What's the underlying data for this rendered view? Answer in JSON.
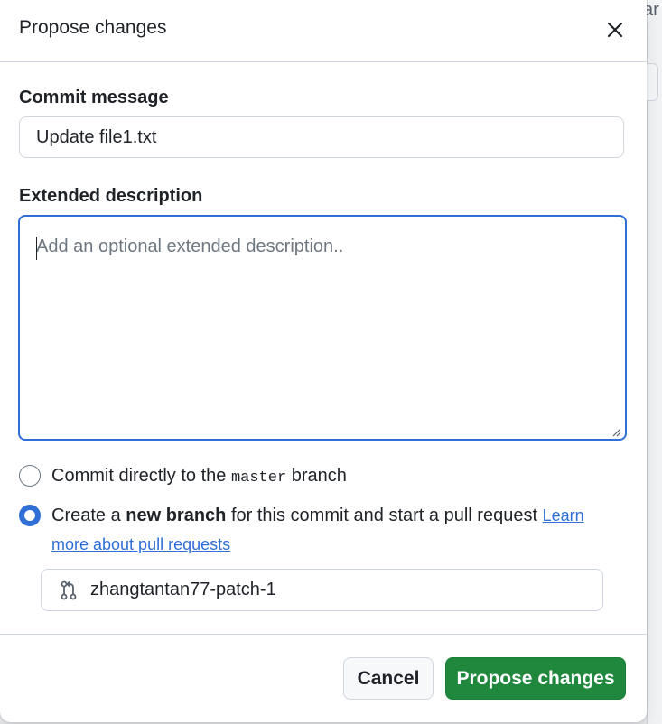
{
  "dialog": {
    "title": "Propose changes",
    "close_icon": "close-icon"
  },
  "commit_message": {
    "label": "Commit message",
    "value": "Update file1.txt"
  },
  "extended_description": {
    "label": "Extended description",
    "placeholder": "Add an optional extended description.."
  },
  "options": {
    "direct": {
      "prefix": "Commit directly to the ",
      "branch": "master",
      "suffix": " branch",
      "checked": false
    },
    "new_branch": {
      "prefix": "Create a ",
      "bold": "new branch",
      "suffix": " for this commit and start a pull request ",
      "link_line1": "Learn",
      "link_line2": "more about pull requests",
      "checked": true
    }
  },
  "branch_name": {
    "icon": "git-pull-request-icon",
    "value": "zhangtantan77-patch-1"
  },
  "buttons": {
    "cancel": "Cancel",
    "propose": "Propose changes"
  },
  "background": {
    "partial_text": "ar"
  },
  "colors": {
    "accent": "#2f6fd6",
    "primary_button": "#1f883d"
  }
}
